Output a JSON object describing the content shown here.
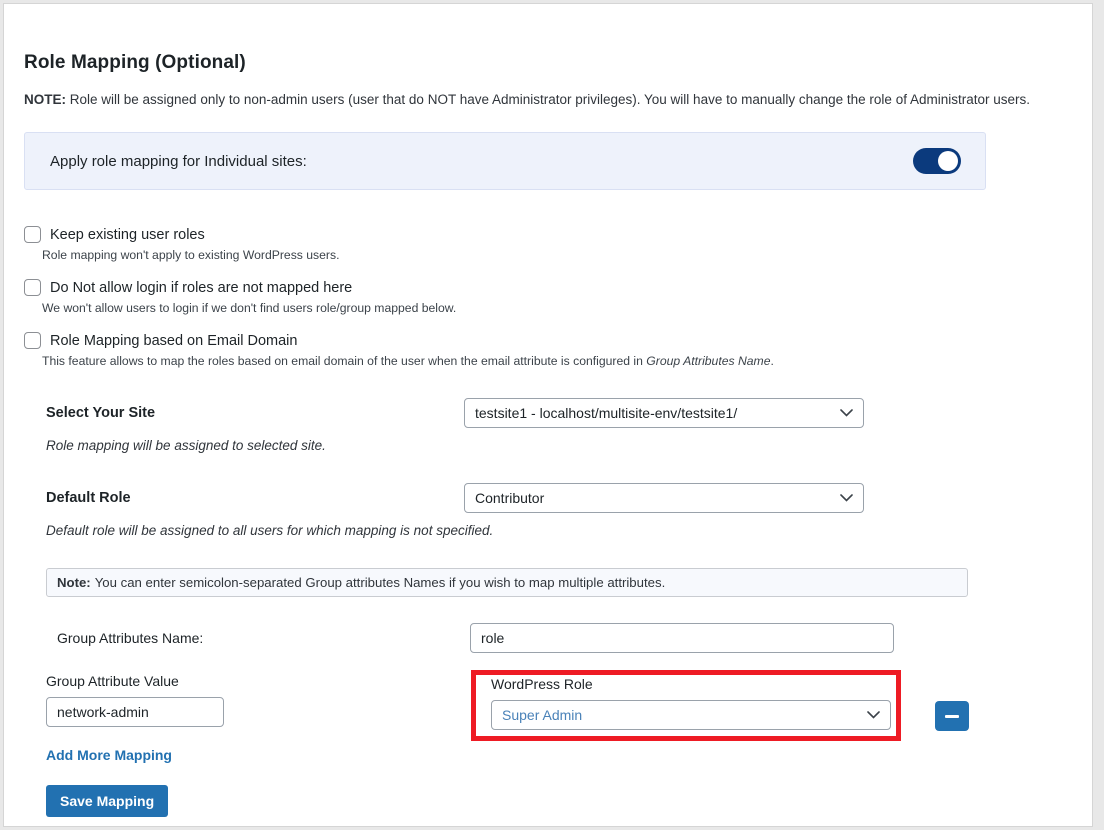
{
  "section": {
    "title": "Role Mapping (Optional)",
    "note_prefix": "NOTE:",
    "note_text": " Role will be assigned only to non-admin users (user that do NOT have Administrator privileges). You will have to manually change the role of Administrator users."
  },
  "apply_bar": {
    "label": "Apply role mapping for Individual sites:",
    "toggle_state": "on",
    "toggle_color": "#0b3a7d"
  },
  "checkboxes": [
    {
      "label": "Keep existing user roles",
      "checked": false,
      "help": "Role mapping won't apply to existing WordPress users."
    },
    {
      "label": "Do Not allow login if roles are not mapped here",
      "checked": false,
      "help": "We won't allow users to login if we don't find users role/group mapped below."
    },
    {
      "label": "Role Mapping based on Email Domain",
      "checked": false,
      "help_before": "This feature allows to map the roles based on email domain of the user when the email attribute is configured in ",
      "help_italic": "Group Attributes Name",
      "help_after": "."
    }
  ],
  "site_field": {
    "label": "Select Your Site",
    "value": "testsite1 - localhost/multisite-env/testsite1/",
    "sub": "Role mapping will be assigned to selected site."
  },
  "default_role_field": {
    "label": "Default Role",
    "value": "Contributor",
    "sub": "Default role will be assigned to all users for which mapping is not specified."
  },
  "note_strip": {
    "prefix": "Note:",
    "text": " You can enter semicolon-separated Group attributes Names if you wish to map multiple attributes."
  },
  "group_attributes": {
    "label": "Group Attributes Name:",
    "value": "role"
  },
  "mapping": {
    "value_column_header": "Group Attribute Value",
    "value": "network-admin",
    "role_column_header": "WordPress Role",
    "role_value": "Super Admin",
    "role_value_color": "#4a82b8",
    "remove_icon": "minus-icon",
    "highlight_color": "#ee1b24"
  },
  "actions": {
    "add_more": "Add More Mapping",
    "save": "Save Mapping",
    "accent_color": "#2271b1"
  }
}
